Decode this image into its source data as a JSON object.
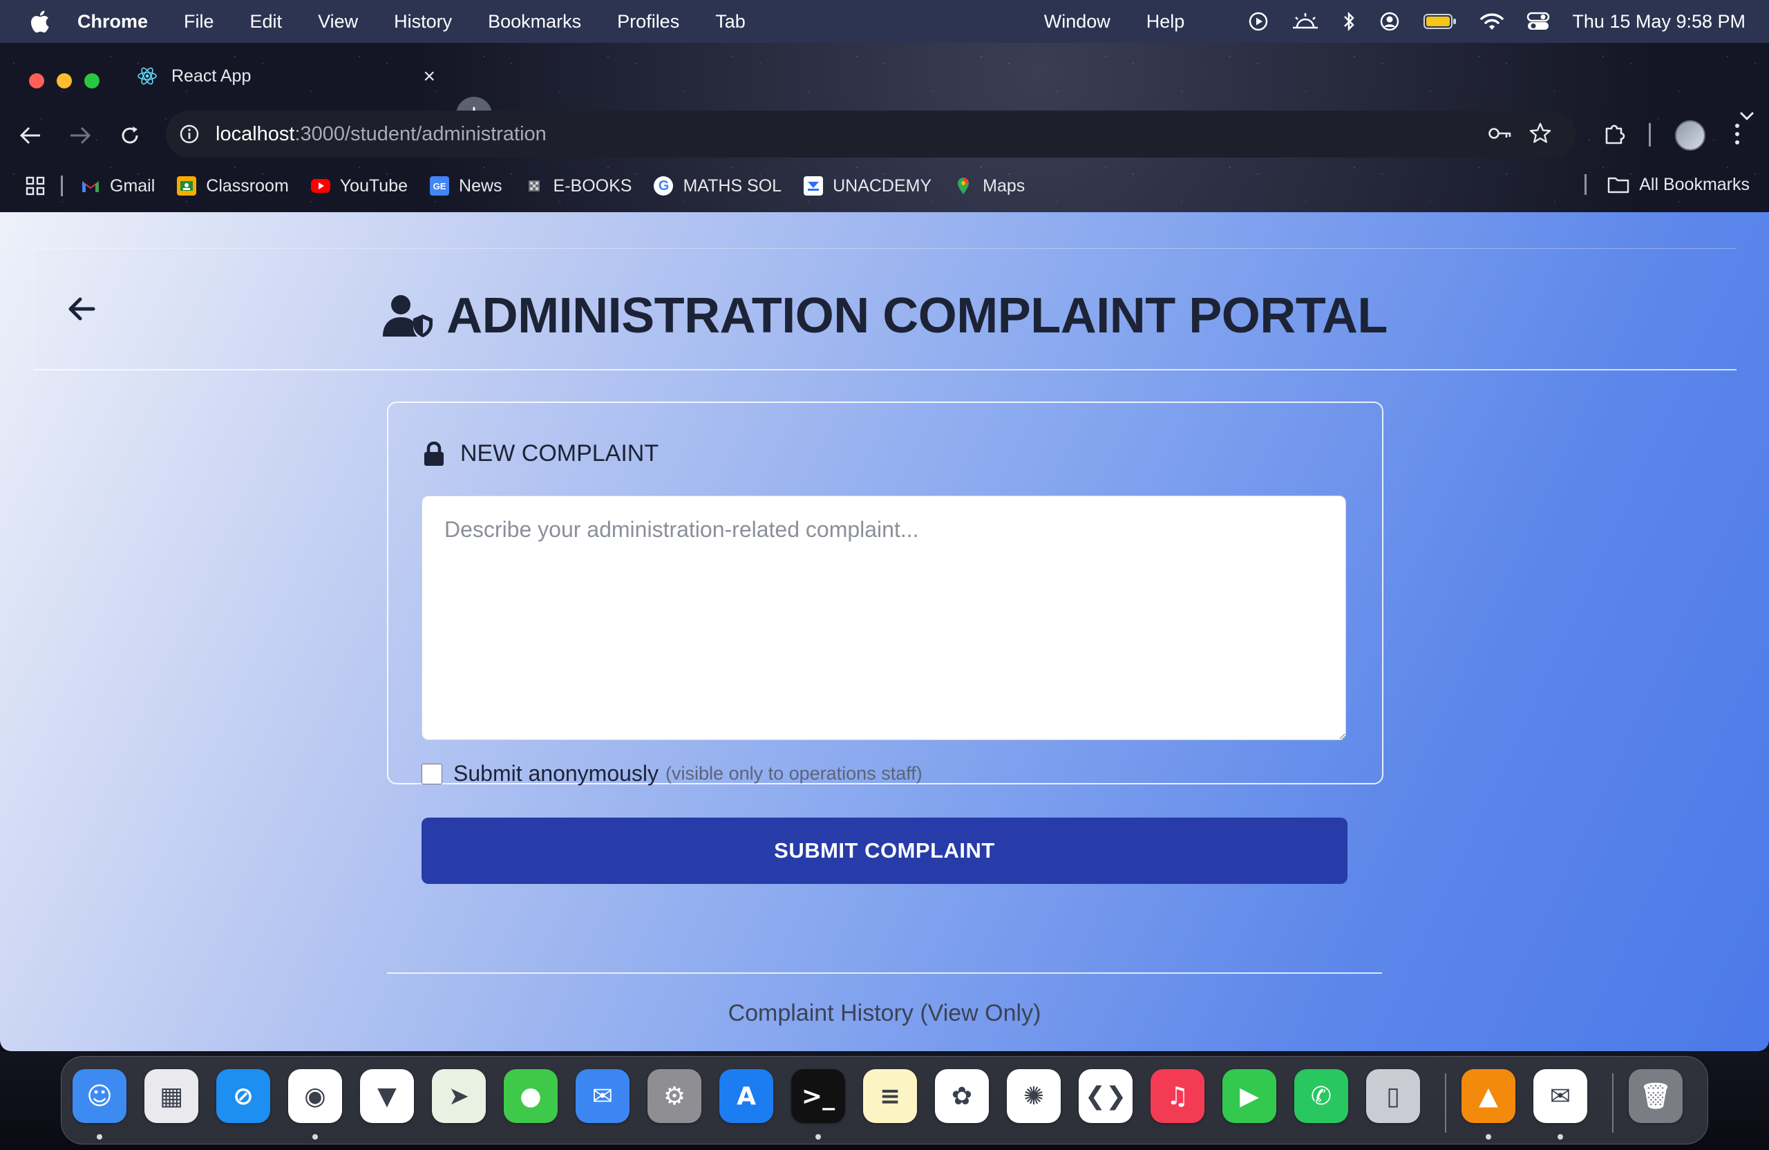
{
  "menubar": {
    "app_name": "Chrome",
    "items": [
      "File",
      "Edit",
      "View",
      "History",
      "Bookmarks",
      "Profiles",
      "Tab"
    ],
    "items_right": [
      "Window",
      "Help"
    ],
    "clock": "Thu 15 May  9:58 PM",
    "status_icons": [
      "play-circle-icon",
      "brightness-icon",
      "bluetooth-icon",
      "user-circle-icon",
      "battery-icon",
      "wifi-icon",
      "control-center-icon"
    ]
  },
  "browser": {
    "tab_title": "React App",
    "url_host": "localhost",
    "url_path": ":3000/student/administration",
    "bookmarks": [
      {
        "label": "Gmail",
        "icon": "gmail-icon",
        "color": "#ea4335"
      },
      {
        "label": "Classroom",
        "icon": "classroom-icon",
        "color": "#f9ab00"
      },
      {
        "label": "YouTube",
        "icon": "youtube-icon",
        "color": "#ff0000"
      },
      {
        "label": "News",
        "icon": "news-icon",
        "color": "#4285f4"
      },
      {
        "label": "E-BOOKS",
        "icon": "ebooks-icon",
        "color": "#8a8a8a"
      },
      {
        "label": "MATHS SOL",
        "icon": "google-icon",
        "color": "#ffffff"
      },
      {
        "label": "UNACDEMY",
        "icon": "unacademy-icon",
        "color": "#2e6ff2"
      },
      {
        "label": "Maps",
        "icon": "maps-icon",
        "color": "#34a853"
      }
    ],
    "all_bookmarks": "All Bookmarks"
  },
  "page": {
    "title": "ADMINISTRATION COMPLAINT PORTAL",
    "form": {
      "heading": "NEW COMPLAINT",
      "complaint_placeholder": "Describe your administration-related complaint...",
      "complaint_value": "",
      "anonymous_label": "Submit anonymously",
      "anonymous_note": "(visible only to operations staff)",
      "anonymous_checked": false,
      "submit_label": "SUBMIT COMPLAINT"
    },
    "history_heading": "Complaint History (View Only)"
  },
  "colors": {
    "accent": "#273ca8",
    "title_text": "#1c2336",
    "gradient_start": "#eef1f9",
    "gradient_end": "#4b79e8"
  },
  "dock": {
    "apps": [
      {
        "name": "finder-icon",
        "color": "#3d8bf0",
        "running": true
      },
      {
        "name": "launchpad-icon",
        "color": "#e9e9ee",
        "running": false
      },
      {
        "name": "safari-icon",
        "color": "#1d8ef2",
        "running": false
      },
      {
        "name": "chrome-icon",
        "color": "#ffffff",
        "running": true
      },
      {
        "name": "brave-icon",
        "color": "#ffffff",
        "running": false
      },
      {
        "name": "maps-app-icon",
        "color": "#e9f1e2",
        "running": false
      },
      {
        "name": "messages-icon",
        "color": "#3fc94a",
        "running": false
      },
      {
        "name": "mail-icon",
        "color": "#3b86f1",
        "running": false
      },
      {
        "name": "system-settings-icon",
        "color": "#8e8e93",
        "running": false
      },
      {
        "name": "app-store-icon",
        "color": "#1c7cf2",
        "running": false
      },
      {
        "name": "terminal-icon",
        "color": "#111111",
        "running": true
      },
      {
        "name": "notes-icon",
        "color": "#fdf4c4",
        "running": false
      },
      {
        "name": "photos-icon",
        "color": "#ffffff",
        "running": false
      },
      {
        "name": "chatgpt-icon",
        "color": "#ffffff",
        "running": false
      },
      {
        "name": "vscode-icon",
        "color": "#ffffff",
        "running": false
      },
      {
        "name": "music-icon",
        "color": "#f43b54",
        "running": false
      },
      {
        "name": "facetime-icon",
        "color": "#33c94f",
        "running": false
      },
      {
        "name": "whatsapp-icon",
        "color": "#29c760",
        "running": false
      },
      {
        "name": "iphone-mirroring-icon",
        "color": "#c9ccd3",
        "running": false
      },
      {
        "name": "vlc-icon",
        "color": "#f48a0b",
        "running": true
      },
      {
        "name": "airmail-icon",
        "color": "#ffffff",
        "running": true
      },
      {
        "name": "trash-icon",
        "color": "#7a7d84",
        "running": false
      }
    ]
  }
}
